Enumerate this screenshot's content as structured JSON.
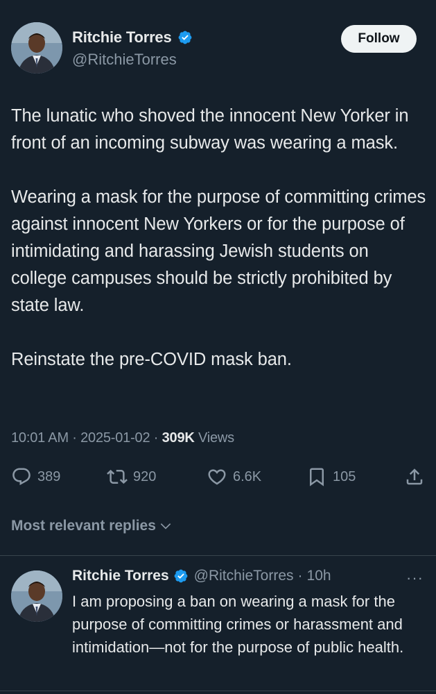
{
  "author": {
    "display_name": "Ritchie Torres",
    "handle": "@RitchieTorres",
    "verified": true,
    "follow_label": "Follow"
  },
  "tweet": {
    "paragraphs": [
      "The lunatic who shoved the innocent New Yorker in front of an incoming subway was wearing a mask.",
      "Wearing a mask for the purpose of committing crimes against innocent New Yorkers or for the purpose of intimidating and harassing Jewish students on college campuses should be strictly prohibited by state law.",
      "Reinstate the pre-COVID mask ban."
    ],
    "time": "10:01 AM",
    "date": "2025-01-02",
    "separator": "·",
    "views_count": "309K",
    "views_label": "Views"
  },
  "actions": {
    "replies": "389",
    "reposts": "920",
    "likes": "6.6K",
    "bookmarks": "105"
  },
  "icons": {
    "reply": "reply-icon",
    "repost": "repost-icon",
    "like": "heart-icon",
    "bookmark": "bookmark-icon",
    "share": "share-icon",
    "verified": "verified-badge-icon",
    "more": "more-icon",
    "chevron": "chevron-down-icon"
  },
  "replies_sort": {
    "label": "Most relevant replies"
  },
  "reply": {
    "display_name": "Ritchie Torres",
    "handle": "@RitchieTorres",
    "separator": "·",
    "time": "10h",
    "more": "···",
    "text": "I am proposing a ban on wearing a mask for the purpose of committing crimes or harassment and intimidation—not for the purpose of public health."
  },
  "colors": {
    "background": "#15202b",
    "text": "#e7e9ea",
    "muted": "#8b98a5",
    "verified": "#1d9bf0",
    "divider": "#38444d"
  }
}
